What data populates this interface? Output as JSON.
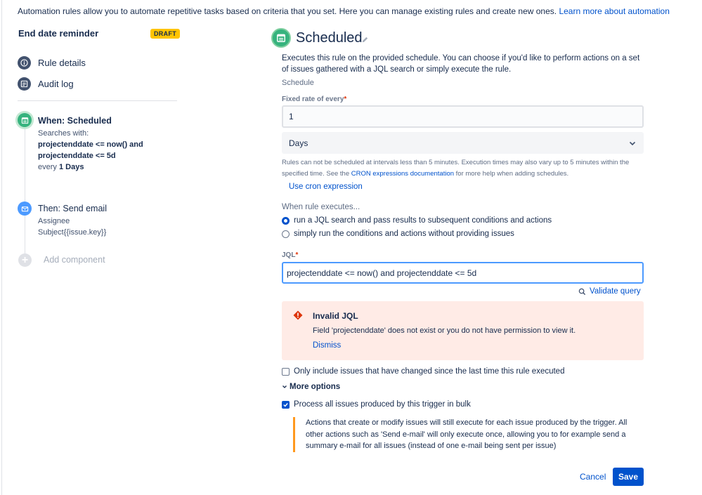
{
  "intro": {
    "text": "Automation rules allow you to automate repetitive tasks based on criteria that you set. Here you can manage existing rules and create new ones.",
    "link": "Learn more about automation"
  },
  "sidebar": {
    "rule_name": "End date reminder",
    "status": "DRAFT",
    "nav": [
      {
        "label": "Rule details",
        "icon": "info-icon"
      },
      {
        "label": "Audit log",
        "icon": "audit-log-icon"
      }
    ],
    "trigger": {
      "title": "When: Scheduled",
      "line1": "Searches with:",
      "jql_line1": "projectenddate <= now() and",
      "jql_line2": "projectenddate <= 5d",
      "every_prefix": "every",
      "every_value": "1 Days"
    },
    "action": {
      "title": "Then: Send email",
      "line1": "Assignee",
      "line2": "Subject{{issue.key}}"
    },
    "add_component": "Add component"
  },
  "main": {
    "title": "Scheduled",
    "description": "Executes this rule on the provided schedule. You can choose if you'd like to perform actions on a set of issues gathered with a JQL search or simply execute the rule.",
    "schedule_label": "Schedule",
    "rate_label": "Fixed rate of every",
    "rate_value": "1",
    "unit_value": "Days",
    "help_text_1": "Rules can not be scheduled at intervals less than 5 minutes. Execution times may also vary up to 5 minutes within the specified time. See the",
    "help_link": "CRON expressions documentation",
    "help_text_2": "for more help when adding schedules.",
    "use_cron": "Use cron expression",
    "when_executes": "When rule executes...",
    "radio_1": "run a JQL search and pass results to subsequent conditions and actions",
    "radio_2": "simply run the conditions and actions without providing issues",
    "jql_label": "JQL",
    "jql_value": "projectenddate <= now() and projectenddate <= 5d",
    "validate": "Validate query",
    "error": {
      "title": "Invalid JQL",
      "message": "Field 'projectenddate' does not exist or you do not have permission to view it.",
      "dismiss": "Dismiss"
    },
    "only_changed": "Only include issues that have changed since the last time this rule executed",
    "more_options": "More options",
    "bulk": "Process all issues produced by this trigger in bulk",
    "note": "Actions that create or modify issues will still execute for each issue produced by the trigger. All other actions such as 'Send e-mail' will only execute once, allowing you to for example send a summary e-mail for all issues (instead of one e-mail being sent per issue)",
    "cancel": "Cancel",
    "save": "Save"
  },
  "colors": {
    "accent": "#0052cc",
    "trigger": "#36b37e",
    "action": "#4c9aff",
    "draft": "#ffc400",
    "error_bg": "#ffebe6",
    "warning_bar": "#ff991f"
  }
}
